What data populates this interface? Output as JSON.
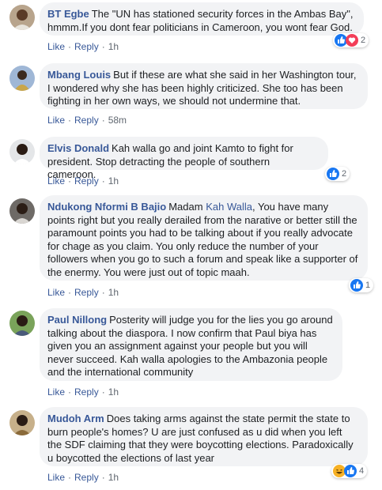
{
  "comments": [
    {
      "author": "BT Egbe",
      "text": "The \"UN has stationed security forces in the Ambas Bay\", hmmm.If you dont fear politicians in Cameroon, you wont fear God.",
      "like": "Like",
      "reply": "Reply",
      "time": "1h",
      "reaction_count": "2",
      "reactions": [
        "like-icon",
        "love-icon"
      ]
    },
    {
      "author": "Mbang Louis",
      "text": "But if these are what she said in her Washington tour, I wondered why she has been highly criticized. She too has been fighting in her own ways, we should not undermine that.",
      "like": "Like",
      "reply": "Reply",
      "time": "58m"
    },
    {
      "author": "Elvis Donald",
      "text": "Kah walla go and joint Kamto to fight for president. Stop detracting the people of southern cameroon.",
      "like": "Like",
      "reply": "Reply",
      "time": "1h",
      "reaction_count": "2",
      "reactions": [
        "like-icon"
      ]
    },
    {
      "author": "Ndukong Nformi B Bajio",
      "mention": "Kah Walla",
      "text_before": "Madam",
      "text": ", You have many points right but you really derailed from the narative or better still the paramount points you had to be talking about if you really advocate for chage as you claim. You only reduce the number of your followers when you go to such a forum and speak like a supporter of the enermy. You were just out of topic maah.",
      "like": "Like",
      "reply": "Reply",
      "time": "1h",
      "reaction_count": "1",
      "reactions": [
        "like-icon"
      ]
    },
    {
      "author": "Paul Nillong",
      "text": "Posterity will judge you for the lies you go around talking about the diaspora. I now confirm that Paul biya has given you an assignment against your people but you will never succeed. Kah walla apologies to the Ambazonia people and the international community",
      "like": "Like",
      "reply": "Reply",
      "time": "1h"
    },
    {
      "author": "Mudoh Arm",
      "text": "Does taking arms against the state permit the state to burn people's homes? U are just confused as u did when you left the SDF claiming that they were boycotting elections. Paradoxically u boycotted the elections of last year",
      "like": "Like",
      "reply": "Reply",
      "time": "1h",
      "reaction_count": "4",
      "reactions": [
        "haha-icon",
        "like-icon"
      ]
    }
  ],
  "colors": {
    "link": "#385898",
    "bubble": "#f2f3f5",
    "meta": "#606770",
    "like": "#1877f2",
    "love": "#f33e58",
    "haha": "#f7b125"
  }
}
